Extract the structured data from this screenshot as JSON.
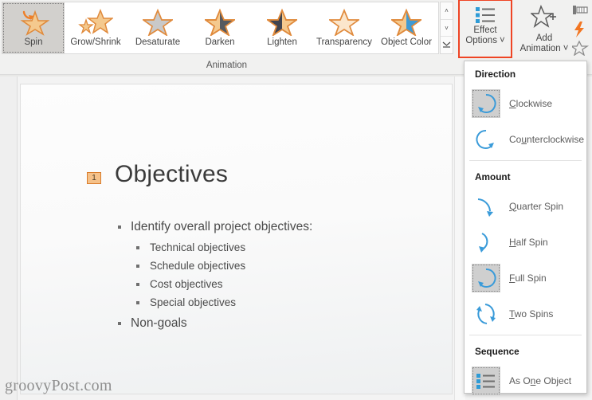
{
  "ribbon": {
    "gallery": [
      {
        "label": "Spin",
        "icon": "spin-star-icon",
        "selected": true
      },
      {
        "label": "Grow/Shrink",
        "icon": "grow-shrink-star-icon",
        "selected": false
      },
      {
        "label": "Desaturate",
        "icon": "desaturate-star-icon",
        "selected": false
      },
      {
        "label": "Darken",
        "icon": "darken-star-icon",
        "selected": false
      },
      {
        "label": "Lighten",
        "icon": "lighten-star-icon",
        "selected": false
      },
      {
        "label": "Transparency",
        "icon": "transparency-star-icon",
        "selected": false
      },
      {
        "label": "Object Color",
        "icon": "object-color-star-icon",
        "selected": false
      }
    ],
    "scroll": {
      "up": "˄",
      "down": "˅",
      "more": "˅"
    },
    "effect_options": {
      "line1": "Effect",
      "line2": "Options",
      "caret": "˅",
      "icon": "bullet-list-icon",
      "highlight_color": "#ef4424"
    },
    "add_animation": {
      "line1": "Add",
      "line2": "Animation",
      "caret": "˅",
      "icon": "star-plus-icon"
    },
    "group_label": "Animation"
  },
  "slide": {
    "animation_tag": "1",
    "title": "Objectives",
    "bullets": [
      {
        "level": 1,
        "text": "Identify overall project objectives:"
      },
      {
        "level": 2,
        "text": "Technical objectives"
      },
      {
        "level": 2,
        "text": "Schedule objectives"
      },
      {
        "level": 2,
        "text": "Cost objectives"
      },
      {
        "level": 2,
        "text": "Special objectives"
      },
      {
        "level": 1,
        "text": "Non-goals"
      }
    ],
    "watermark": "groovyPost.com"
  },
  "menu": {
    "sections": [
      {
        "header": "Direction",
        "items": [
          {
            "label": "Clockwise",
            "underline": "C",
            "icon": "clockwise-arrow-icon",
            "selected": true
          },
          {
            "label": "Counterclockwise",
            "underline": "u",
            "icon": "counterclockwise-arrow-icon",
            "selected": false
          }
        ]
      },
      {
        "header": "Amount",
        "items": [
          {
            "label": "Quarter Spin",
            "underline": "Q",
            "icon": "quarter-spin-icon",
            "selected": false
          },
          {
            "label": "Half Spin",
            "underline": "H",
            "icon": "half-spin-icon",
            "selected": false
          },
          {
            "label": "Full Spin",
            "underline": "F",
            "icon": "full-spin-icon",
            "selected": true
          },
          {
            "label": "Two Spins",
            "underline": "T",
            "icon": "two-spins-icon",
            "selected": false
          }
        ]
      },
      {
        "header": "Sequence",
        "items": [
          {
            "label": "As One Object",
            "underline": "n",
            "icon": "as-one-object-icon",
            "selected": true
          }
        ]
      }
    ]
  },
  "colors": {
    "accent_blue": "#2e9bd6",
    "star_orange": "#e8913c",
    "star_fill": "#f4c98e",
    "highlight_red": "#ef4424",
    "tag_orange": "#f5c189"
  }
}
